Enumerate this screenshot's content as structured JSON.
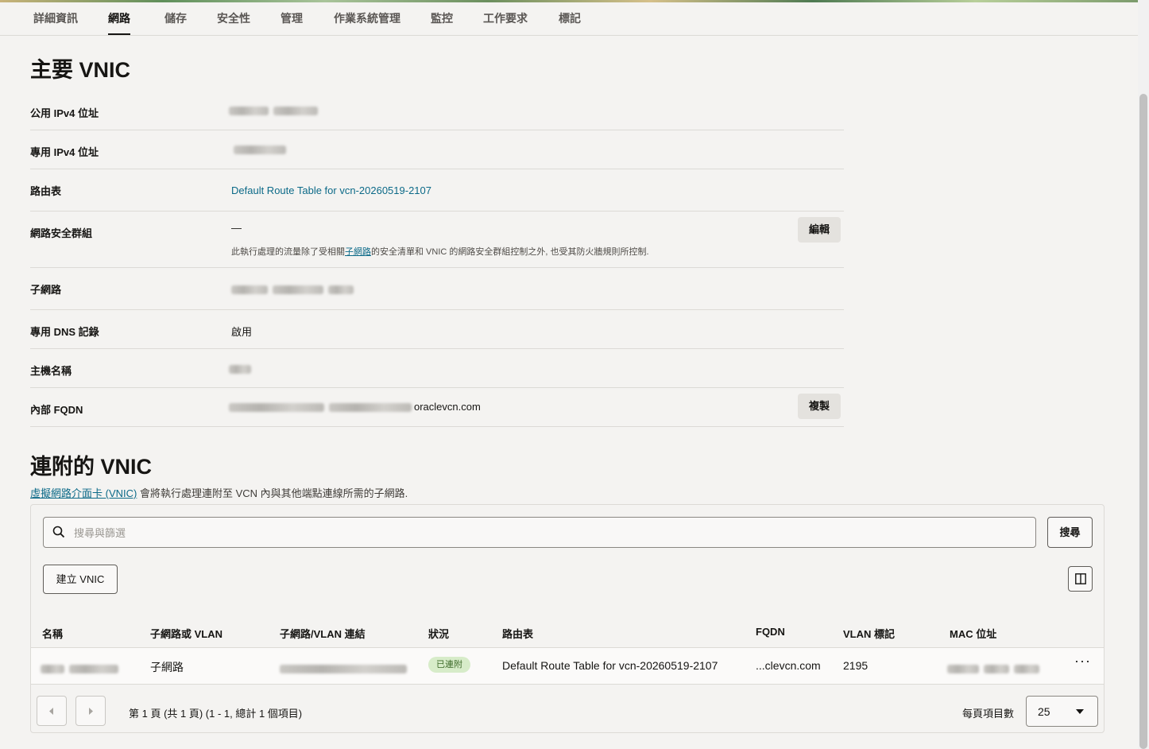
{
  "tabs": [
    "詳細資訊",
    "網路",
    "儲存",
    "安全性",
    "管理",
    "作業系統管理",
    "監控",
    "工作要求",
    "標記"
  ],
  "primary_vnic": {
    "title": "主要 VNIC",
    "public_ipv4_label": "公用 IPv4 位址",
    "private_ipv4_label": "專用 IPv4 位址",
    "route_table_label": "路由表",
    "route_table_value": "Default Route Table for vcn-20260519-2107",
    "nsg_label": "網路安全群組",
    "nsg_value": "—",
    "nsg_edit": "編輯",
    "nsg_note_before": "此執行處理的流量除了受相關",
    "nsg_note_link": "子網路",
    "nsg_note_after": "的安全清單和 VNIC 的網路安全群組控制之外, 也受其防火牆規則所控制.",
    "subnet_label": "子網路",
    "dns_label": "專用 DNS 記錄",
    "dns_value": "啟用",
    "hostname_label": "主機名稱",
    "fqdn_label": "內部 FQDN",
    "fqdn_suffix": "oraclevcn.com",
    "copy": "複製"
  },
  "attached_vnics": {
    "title": "連附的 VNIC",
    "desc_link": "虛擬網路介面卡 (VNIC)",
    "desc_text": " 會將執行處理連附至 VCN 內與其他端點連線所需的子網路.",
    "search_placeholder": "搜尋與篩選",
    "search_button": "搜尋",
    "create_button": "建立 VNIC",
    "columns": [
      "名稱",
      "子網路或 VLAN",
      "子網路/VLAN 連結",
      "狀況",
      "路由表",
      "FQDN",
      "VLAN 標記",
      "MAC 位址"
    ],
    "row": {
      "type": "子網路",
      "status": "已連附",
      "route_table": "Default Route Table for vcn-20260519-2107",
      "fqdn": "...clevcn.com",
      "vlan_tag": "2195"
    },
    "pagination": "第 1 頁 (共 1 頁) (1 - 1, 總計 1 個項目)",
    "per_page_label": "每頁項目數",
    "per_page_value": "25"
  }
}
